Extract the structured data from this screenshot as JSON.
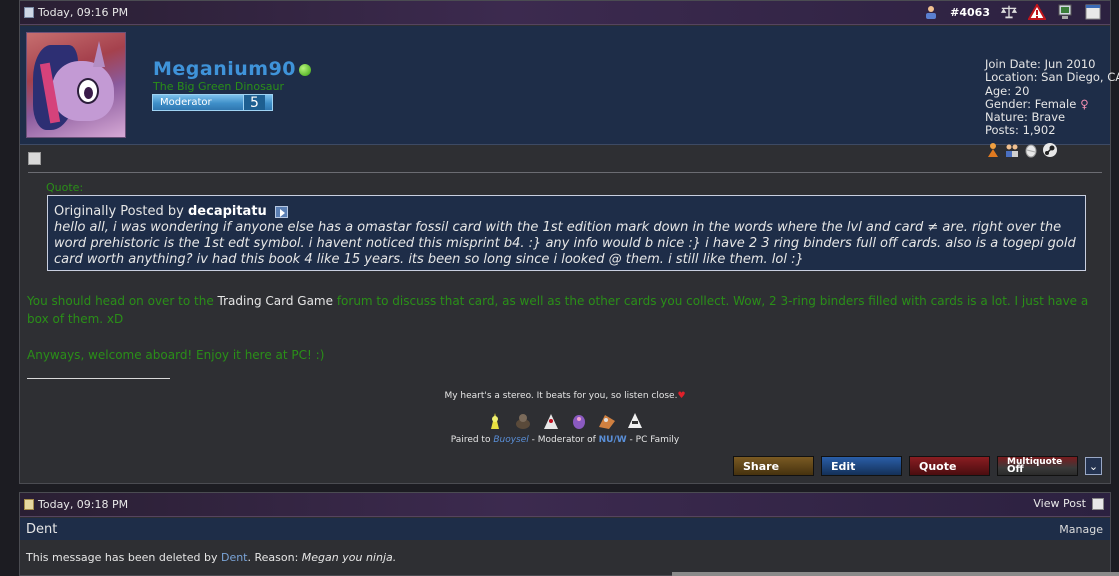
{
  "post1": {
    "date": "Today, 09:16 PM",
    "post_number": "#4063",
    "user": {
      "name": "Meganium90",
      "title": "The Big Green Dinosaur",
      "rank_label": "Moderator",
      "rank_level": "5",
      "join_date": "Join Date: Jun 2010",
      "location": "Location: San Diego, CA",
      "age": "Age: 20",
      "gender": "Gender: Female",
      "gender_symbol": "♀",
      "nature": "Nature: Brave",
      "posts": "Posts: 1,902"
    },
    "quote": {
      "label": "Quote:",
      "originally_posted_by": "Originally Posted by",
      "author": "decapitatu",
      "text": "hello all, i was wondering if anyone else has a omastar fossil card with the 1st edition mark down in the words where the lvl and card ≠ are. right over the word prehistoric is the 1st edt symbol. i havent noticed this misprint b4. :} any info would b nice :} i have 2 3 ring binders full off cards. also is a togepi gold card worth anything? iv had this book 4 like 15 years. its been so long since i looked @ them. i still like them. lol :}"
    },
    "message": {
      "part1": "You should head on over to the ",
      "link": "Trading Card Game",
      "part2": " forum to discuss that card, as well as the other cards you collect. Wow, 2 3-ring binders filled with cards is a lot. I just have a box of them. xD",
      "line2": "Anyways, welcome aboard! Enjoy it here at PC! :)"
    },
    "signature": {
      "line1": "My heart's a stereo. It beats for you, so listen close.",
      "heart": "♥",
      "paired_prefix": "Paired to ",
      "paired_mon": "Buoysel",
      "mod_of": " - Moderator of ",
      "tier": "NU/W",
      "family": " - PC Family"
    },
    "actions": {
      "share": "Share",
      "edit": "Edit",
      "quote": "Quote",
      "multiquote": "Multiquote",
      "multiquote_state": "Off",
      "expand": "⌄"
    }
  },
  "post2": {
    "date": "Today, 09:18 PM",
    "view_post": "View Post",
    "username": "Dent",
    "manage": "Manage",
    "deleted_prefix": "This message has been deleted by ",
    "deleted_by": "Dent",
    "reason_label": ". Reason: ",
    "reason": "Megan you ninja."
  },
  "colors": {
    "accent_blue": "#3f93d9",
    "green_text": "#2a8f18",
    "panel_bg": "#1e2d48",
    "post_bg": "#2e2f33"
  }
}
